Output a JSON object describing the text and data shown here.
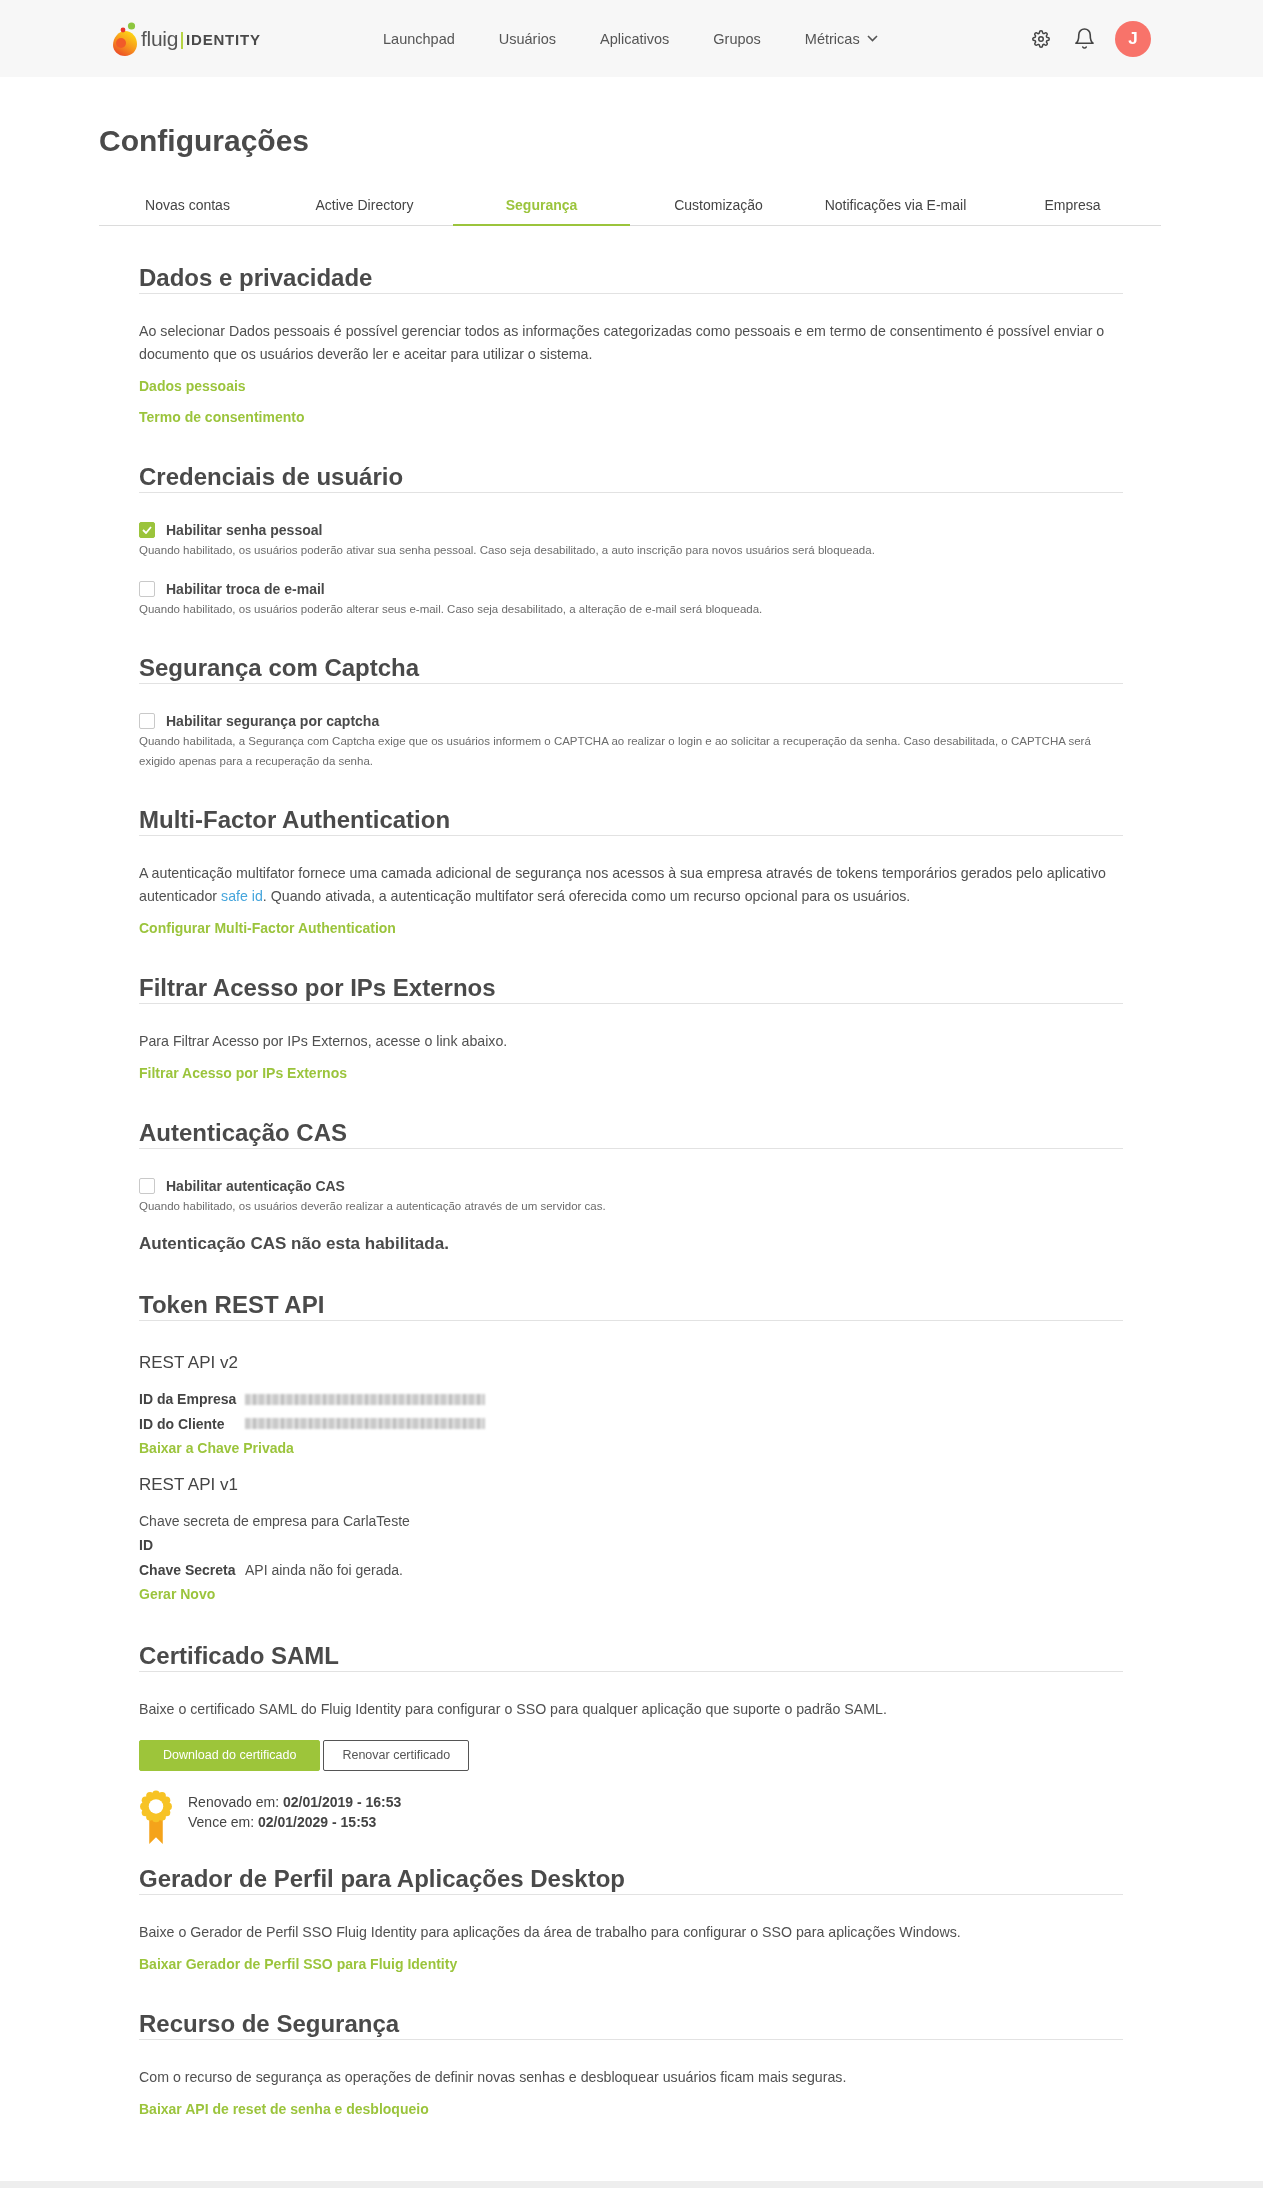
{
  "header": {
    "logo": {
      "brand": "fluig",
      "product": "IDENTITY"
    },
    "nav": [
      {
        "label": "Launchpad",
        "dropdown": false
      },
      {
        "label": "Usuários",
        "dropdown": false
      },
      {
        "label": "Aplicativos",
        "dropdown": false
      },
      {
        "label": "Grupos",
        "dropdown": false
      },
      {
        "label": "Métricas",
        "dropdown": true
      }
    ],
    "avatar": {
      "initial": "J"
    }
  },
  "page": {
    "title": "Configurações"
  },
  "tabs": [
    {
      "label": "Novas contas",
      "selected": false
    },
    {
      "label": "Active Directory",
      "selected": false
    },
    {
      "label": "Segurança",
      "selected": true
    },
    {
      "label": "Customização",
      "selected": false
    },
    {
      "label": "Notificações via E-mail",
      "selected": false
    },
    {
      "label": "Empresa",
      "selected": false
    }
  ],
  "sections": [
    {
      "title": "Dados e privacidade",
      "blocks": [
        {
          "kind": "paragraph",
          "text": "Ao selecionar Dados pessoais é possível gerenciar todos as informações categorizadas como pessoais e em termo de consentimento é possível enviar o documento que os usuários deverão ler e aceitar para utilizar o sistema."
        },
        {
          "kind": "link",
          "text": "Dados pessoais"
        },
        {
          "kind": "link",
          "text": "Termo de consentimento"
        }
      ]
    },
    {
      "title": "Credenciais de usuário",
      "blocks": [
        {
          "kind": "checkbox",
          "label": "Habilitar senha pessoal",
          "checked": true,
          "help": "Quando habilitado, os usuários poderão ativar sua senha pessoal. Caso seja desabilitado, a auto inscrição para novos usuários será bloqueada."
        },
        {
          "kind": "checkbox",
          "label": "Habilitar troca de e-mail",
          "checked": false,
          "help": "Quando habilitado, os usuários poderão alterar seus e-mail. Caso seja desabilitado, a alteração de e-mail será bloqueada."
        }
      ]
    },
    {
      "title": "Segurança com Captcha",
      "blocks": [
        {
          "kind": "checkbox",
          "label": "Habilitar segurança por captcha",
          "checked": false,
          "help": "Quando habilitada, a Segurança com Captcha exige que os usuários informem o CAPTCHA ao realizar o login e ao solicitar a recuperação da senha. Caso desabilitada, o CAPTCHA será exigido apenas para a recuperação da senha."
        }
      ]
    },
    {
      "title": "Multi-Factor Authentication",
      "blocks": [
        {
          "kind": "paragraph",
          "text": "A autenticação multifator fornece uma camada adicional de segurança nos acessos à sua empresa através de tokens temporários gerados pelo aplicativo autenticador ",
          "inline_link": "safe id",
          "text_after": ". Quando ativada, a autenticação multifator será oferecida como um recurso opcional para os usuários."
        },
        {
          "kind": "link",
          "text": "Configurar Multi-Factor Authentication"
        }
      ]
    },
    {
      "title": "Filtrar Acesso por IPs Externos",
      "blocks": [
        {
          "kind": "paragraph",
          "text": "Para Filtrar Acesso por IPs Externos, acesse o link abaixo."
        },
        {
          "kind": "link",
          "text": "Filtrar Acesso por IPs Externos"
        }
      ]
    },
    {
      "title": "Autenticação CAS",
      "blocks": [
        {
          "kind": "checkbox",
          "label": "Habilitar autenticação CAS",
          "checked": false,
          "help": "Quando habilitado, os usuários deverão realizar a autenticação através de um servidor cas."
        },
        {
          "kind": "status",
          "text": "Autenticação CAS não esta habilitada."
        }
      ]
    },
    {
      "title": "Token REST API",
      "blocks": [
        {
          "kind": "subheading",
          "text": "REST API v2"
        },
        {
          "kind": "blurred_value",
          "label": "ID da Empresa"
        },
        {
          "kind": "blurred_value",
          "label": "ID do Cliente"
        },
        {
          "kind": "link",
          "text": "Baixar a Chave Privada"
        },
        {
          "kind": "subheading",
          "text": "REST API v1"
        },
        {
          "kind": "text",
          "text": "Chave secreta de empresa para CarlaTeste"
        },
        {
          "kind": "key_value",
          "label": "ID"
        },
        {
          "kind": "key_value",
          "label": "Chave Secreta",
          "value": "API ainda não foi gerada."
        },
        {
          "kind": "link",
          "text": "Gerar Novo"
        }
      ]
    },
    {
      "title": "Certificado SAML",
      "blocks": [
        {
          "kind": "paragraph",
          "text": "Baixe o certificado SAML do Fluig Identity para configurar o SSO para qualquer aplicação que suporte o padrão SAML."
        },
        {
          "kind": "buttons",
          "buttons": [
            {
              "label": "Download do certificado",
              "primary": true
            },
            {
              "label": "Renovar certificado",
              "primary": false
            }
          ]
        },
        {
          "kind": "certificate",
          "lines": [
            "Renovado em: **02/01/2019 - 16:53**",
            "Vence em: **02/01/2029 - 15:53**"
          ]
        }
      ]
    },
    {
      "title": "Gerador de Perfil para Aplicações Desktop",
      "blocks": [
        {
          "kind": "paragraph",
          "text": "Baixe o Gerador de Perfil SSO Fluig Identity para aplicações da área de trabalho para configurar o SSO para aplicações Windows."
        },
        {
          "kind": "link",
          "text": "Baixar Gerador de Perfil SSO para Fluig Identity"
        }
      ]
    },
    {
      "title": "Recurso de Segurança",
      "blocks": [
        {
          "kind": "paragraph",
          "text": "Com o recurso de segurança as operações de definir novas senhas e desbloquear usuários ficam mais seguras."
        },
        {
          "kind": "link",
          "text": "Baixar API de reset de senha e desbloqueio"
        }
      ]
    }
  ]
}
